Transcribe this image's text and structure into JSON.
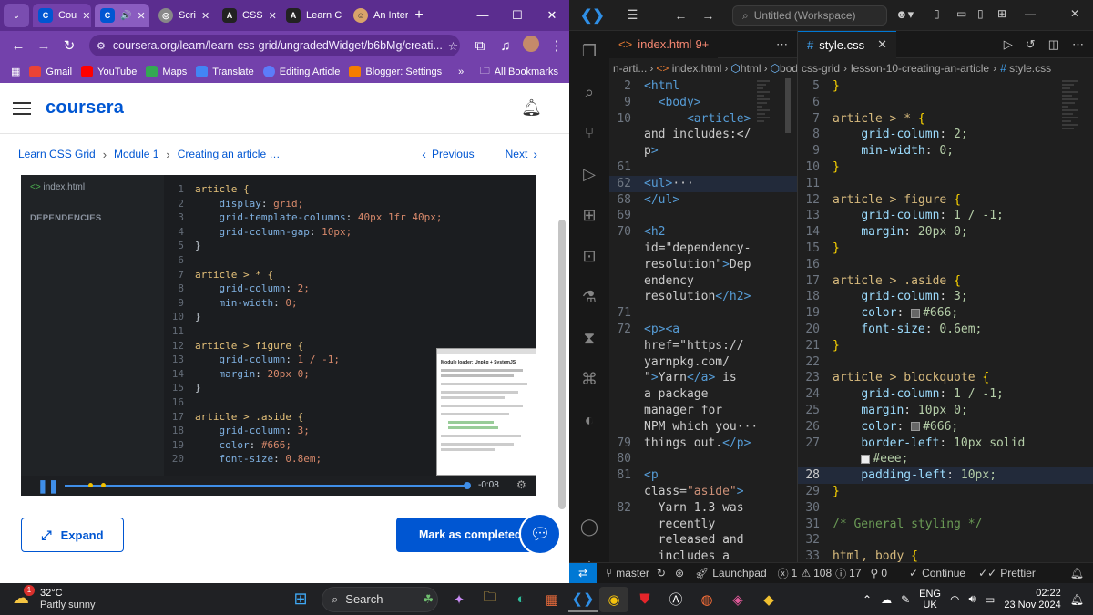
{
  "browser": {
    "tabs": [
      {
        "label": "Cou",
        "icon": "coursera-icon"
      },
      {
        "label": "",
        "icon": "coursera-icon"
      },
      {
        "label": "Scri",
        "icon": "scrimba-icon"
      },
      {
        "label": "CSS",
        "icon": "codepen-icon"
      },
      {
        "label": "Learn C",
        "icon": "codepen-icon"
      },
      {
        "label": "An Inter",
        "icon": "avatar-icon"
      }
    ],
    "new_tab": "+",
    "url": "coursera.org/learn/learn-css-grid/ungradedWidget/b6bMg/creati...",
    "bookmarks": [
      "Gmail",
      "YouTube",
      "Maps",
      "Translate",
      "Editing Article",
      "Blogger: Settings"
    ],
    "more_bookmarks": "»",
    "all_bookmarks": "All Bookmarks"
  },
  "coursera": {
    "logo": "coursera",
    "breadcrumbs": [
      "Learn CSS Grid",
      "Module 1",
      "Creating an article …"
    ],
    "previous": "Previous",
    "next": "Next",
    "file_label": "index.html",
    "dependencies_label": "DEPENDENCIES",
    "code_lines": [
      {
        "n": "1",
        "t": "article {"
      },
      {
        "n": "2",
        "t": "    display: grid;"
      },
      {
        "n": "3",
        "t": "    grid-template-columns: 40px 1fr 40px;"
      },
      {
        "n": "4",
        "t": "    grid-column-gap: 10px;"
      },
      {
        "n": "5",
        "t": "}"
      },
      {
        "n": "6",
        "t": ""
      },
      {
        "n": "7",
        "t": "article > * {"
      },
      {
        "n": "8",
        "t": "    grid-column: 2;"
      },
      {
        "n": "9",
        "t": "    min-width: 0;"
      },
      {
        "n": "10",
        "t": "}"
      },
      {
        "n": "11",
        "t": ""
      },
      {
        "n": "12",
        "t": "article > figure {"
      },
      {
        "n": "13",
        "t": "    grid-column: 1 / -1;"
      },
      {
        "n": "14",
        "t": "    margin: 20px 0;"
      },
      {
        "n": "15",
        "t": "}"
      },
      {
        "n": "16",
        "t": ""
      },
      {
        "n": "17",
        "t": "article > .aside {"
      },
      {
        "n": "18",
        "t": "    grid-column: 3;"
      },
      {
        "n": "19",
        "t": "    color: #666;"
      },
      {
        "n": "20",
        "t": "    font-size: 0.8em;"
      }
    ],
    "preview_heading": "Module loader: Unpkg + SystemJS",
    "video_time": "-0:08",
    "expand_label": "Expand",
    "complete_label": "Mark as completed"
  },
  "vscode": {
    "search": "Untitled (Workspace)",
    "left_tab": "index.html",
    "left_tab_badge": "9+",
    "right_tab": "style.css",
    "left_breadcrumb": [
      "n-arti...",
      "index.html",
      "html",
      "body"
    ],
    "right_breadcrumb": [
      "css-grid",
      "lesson-10-creating-an-article",
      "style.css"
    ],
    "html_lines": [
      {
        "n": "2",
        "t": "<html"
      },
      {
        "n": "9",
        "t": "  <body>"
      },
      {
        "n": "10",
        "t": "      <article>"
      },
      {
        "n": "",
        "t": "and includes:</"
      },
      {
        "n": "",
        "t": "p>"
      },
      {
        "n": "61",
        "t": ""
      },
      {
        "n": "62",
        "t": "<ul>···"
      },
      {
        "n": "68",
        "t": "</ul>"
      },
      {
        "n": "69",
        "t": ""
      },
      {
        "n": "70",
        "t": "<h2"
      },
      {
        "n": "",
        "t": "id=\"dependency-"
      },
      {
        "n": "",
        "t": "resolution\">Dep"
      },
      {
        "n": "",
        "t": "endency"
      },
      {
        "n": "",
        "t": "resolution</h2>"
      },
      {
        "n": "71",
        "t": ""
      },
      {
        "n": "72",
        "t": "<p><a"
      },
      {
        "n": "",
        "t": "href=\"https://"
      },
      {
        "n": "",
        "t": "yarnpkg.com/"
      },
      {
        "n": "",
        "t": "\">Yarn</a> is"
      },
      {
        "n": "",
        "t": "a package"
      },
      {
        "n": "",
        "t": "manager for"
      },
      {
        "n": "",
        "t": "NPM which you···"
      },
      {
        "n": "79",
        "t": "things out.</p>"
      },
      {
        "n": "80",
        "t": ""
      },
      {
        "n": "81",
        "t": "<p"
      },
      {
        "n": "",
        "t": "class=\"aside\">"
      },
      {
        "n": "82",
        "t": "  Yarn 1.3 was"
      },
      {
        "n": "",
        "t": "  recently"
      },
      {
        "n": "",
        "t": "  released and"
      },
      {
        "n": "",
        "t": "  includes a"
      }
    ],
    "css_lines": [
      {
        "n": "5",
        "t": "}"
      },
      {
        "n": "6",
        "t": ""
      },
      {
        "n": "7",
        "t": "article > * {"
      },
      {
        "n": "8",
        "t": "    grid-column: 2;"
      },
      {
        "n": "9",
        "t": "    min-width: 0;"
      },
      {
        "n": "10",
        "t": "}"
      },
      {
        "n": "11",
        "t": ""
      },
      {
        "n": "12",
        "t": "article > figure {"
      },
      {
        "n": "13",
        "t": "    grid-column: 1 / -1;"
      },
      {
        "n": "14",
        "t": "    margin: 20px 0;"
      },
      {
        "n": "15",
        "t": "}"
      },
      {
        "n": "16",
        "t": ""
      },
      {
        "n": "17",
        "t": "article > .aside {"
      },
      {
        "n": "18",
        "t": "    grid-column: 3;"
      },
      {
        "n": "19",
        "t": "    color: #666;"
      },
      {
        "n": "20",
        "t": "    font-size: 0.6em;"
      },
      {
        "n": "21",
        "t": "}"
      },
      {
        "n": "22",
        "t": ""
      },
      {
        "n": "23",
        "t": "article > blockquote {"
      },
      {
        "n": "24",
        "t": "    grid-column: 1 / -1;"
      },
      {
        "n": "25",
        "t": "    margin: 10px 0;"
      },
      {
        "n": "26",
        "t": "    color: #666;"
      },
      {
        "n": "27",
        "t": "    border-left: 10px solid"
      },
      {
        "n": "",
        "t": "    #eee;"
      },
      {
        "n": "28",
        "t": "    padding-left: 10px;"
      },
      {
        "n": "29",
        "t": "}"
      },
      {
        "n": "30",
        "t": ""
      },
      {
        "n": "31",
        "t": "/* General styling */"
      },
      {
        "n": "32",
        "t": ""
      },
      {
        "n": "33",
        "t": "html, body {"
      }
    ],
    "status": {
      "branch": "master",
      "launchpad": "Launchpad",
      "errors": "1",
      "warnings": "108",
      "infos": "17",
      "ports": "0",
      "continue": "Continue",
      "prettier": "Prettier"
    }
  },
  "taskbar": {
    "weather_badge": "1",
    "temp": "32°C",
    "weather": "Partly sunny",
    "search": "Search",
    "lang": "ENG",
    "region": "UK",
    "time": "02:22",
    "date": "23 Nov 2024"
  },
  "colors": {
    "chrome_purple": "#7341ab",
    "coursera_blue": "#0056d2",
    "vscode_bg": "#1f1f1f"
  }
}
